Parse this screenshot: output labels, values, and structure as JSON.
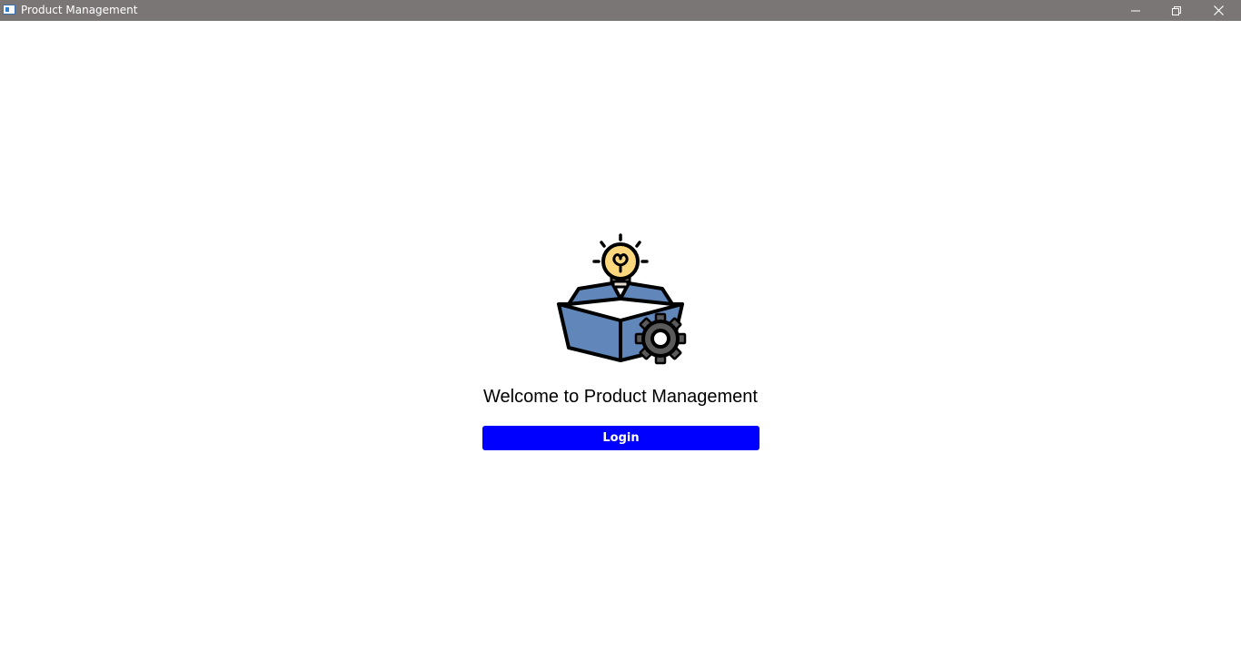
{
  "window": {
    "title": "Product Management",
    "titlebar_color": "#7b7676",
    "icons": {
      "app": "app-window-icon",
      "minimize": "minimize-icon",
      "maximize": "restore-icon",
      "close": "close-icon"
    }
  },
  "main": {
    "logo_icon": "box-lightbulb-gear-icon",
    "welcome_text": "Welcome to Product Management",
    "login_label": "Login",
    "login_color": "#0000ff"
  }
}
